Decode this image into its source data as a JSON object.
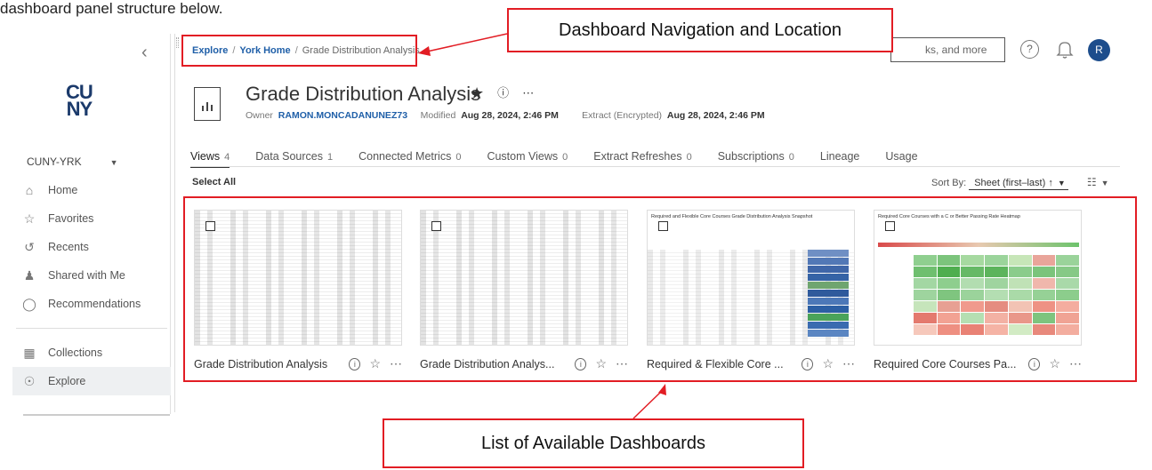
{
  "doc": {
    "top_text": "dashboard panel structure below."
  },
  "callouts": {
    "nav": "Dashboard Navigation and Location",
    "list": "List of Available Dashboards"
  },
  "sidebar": {
    "logo_top": "CU",
    "logo_bottom": "NY",
    "site": "CUNY-YRK",
    "items": [
      {
        "label": "Home",
        "icon": "home-icon"
      },
      {
        "label": "Favorites",
        "icon": "star-icon"
      },
      {
        "label": "Recents",
        "icon": "recents-icon"
      },
      {
        "label": "Shared with Me",
        "icon": "shared-icon"
      },
      {
        "label": "Recommendations",
        "icon": "lightbulb-icon"
      }
    ],
    "items2": [
      {
        "label": "Collections",
        "icon": "collections-icon"
      },
      {
        "label": "Explore",
        "icon": "explore-icon"
      }
    ]
  },
  "breadcrumb": {
    "explore": "Explore",
    "home": "York Home",
    "current": "Grade Distribution Analysis"
  },
  "header": {
    "search_text": "ks, and more",
    "help": "?",
    "avatar": "R"
  },
  "workbook": {
    "title": "Grade Distribution Analysis",
    "owner_label": "Owner",
    "owner": "RAMON.MONCADANUNEZ73",
    "modified_label": "Modified",
    "modified": "Aug 28, 2024, 2:46 PM",
    "extract_label": "Extract (Encrypted)",
    "extract": "Aug 28, 2024, 2:46 PM"
  },
  "tabs": [
    {
      "label": "Views",
      "count": "4"
    },
    {
      "label": "Data Sources",
      "count": "1"
    },
    {
      "label": "Connected Metrics",
      "count": "0"
    },
    {
      "label": "Custom Views",
      "count": "0"
    },
    {
      "label": "Extract Refreshes",
      "count": "0"
    },
    {
      "label": "Subscriptions",
      "count": "0"
    },
    {
      "label": "Lineage",
      "count": ""
    },
    {
      "label": "Usage",
      "count": ""
    }
  ],
  "toolbar": {
    "select_all": "Select All",
    "sort_label": "Sort By:",
    "sort_value": "Sheet (first–last) ↑"
  },
  "cards": [
    {
      "name": "Grade Distribution Analysis",
      "thumb_title": ""
    },
    {
      "name": "Grade Distribution Analys...",
      "thumb_title": ""
    },
    {
      "name": "Required & Flexible Core ...",
      "thumb_title": "Required and Flexible Core Courses Grade Distribution Analysis Snapshot"
    },
    {
      "name": "Required Core Courses Pa...",
      "thumb_title": "Required Core Courses with a C or Better Passing Rate Heatmap"
    }
  ],
  "colors": {
    "accent": "#1f5fa8",
    "callout_border": "#e21d24",
    "avatar_bg": "#1d4d8c"
  }
}
